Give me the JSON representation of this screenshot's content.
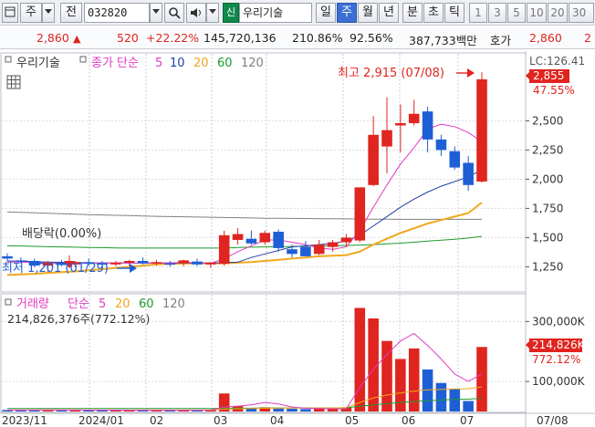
{
  "toolbar": {
    "window_icon": "window-icon",
    "market_label": "주",
    "prev_label": "전",
    "code": "032820",
    "stock_name": "우리기술",
    "period_day": "일",
    "period_week": "주",
    "period_month": "월",
    "period_year": "년",
    "period_min": "분",
    "period_sec": "초",
    "period_tick": "틱",
    "interval_1": "1",
    "interval_3": "3",
    "interval_5": "5",
    "interval_10": "10",
    "interval_20": "20",
    "interval_30": "30"
  },
  "quote": {
    "price": "2,860",
    "change": "520",
    "change_pct": "+22.22%",
    "volume": "145,720,136",
    "vol_ratio": "210.86%",
    "strength": "92.56%",
    "trade_value": "387,733백만",
    "ask_label": "호가",
    "ask_price": "2,860"
  },
  "legend": {
    "stock_name": "우리기술",
    "ma_label": "종가 단순",
    "ma5": "5",
    "ma10": "10",
    "ma20": "20",
    "ma60": "60",
    "ma120": "120",
    "lc": "LC:126.41"
  },
  "annotations": {
    "high": "최고 2,915 (07/08)",
    "dividend": "배당락(0.00%)",
    "low": "최저 1,201 (01/29)"
  },
  "price_label": {
    "price": "2,855",
    "pct": "47.55%"
  },
  "volume_legend": {
    "label": "거래량",
    "ma_label": "단순",
    "ma5": "5",
    "ma20": "20",
    "ma60": "60",
    "ma120": "120",
    "total": "214,826,376주(772.12%)"
  },
  "volume_label": {
    "value": "214,826K",
    "pct": "772.12%"
  },
  "colors": {
    "up": "#e0241f",
    "down": "#1f5fd6",
    "ma5": "#e03cc0",
    "ma10": "#1f3fa8",
    "ma20": "#f0a81e",
    "ma60": "#1c9a2a",
    "ma120": "#808080"
  },
  "chart_data": {
    "type": "candlestick",
    "price_axis": {
      "ticks": [
        "2,500",
        "2,250",
        "2,000",
        "1,750",
        "1,500",
        "1,250"
      ],
      "tick_values": [
        2500,
        2250,
        2000,
        1750,
        1500,
        1250
      ],
      "ylim": [
        1050,
        3050
      ]
    },
    "volume_axis": {
      "ticks": [
        "300,000K",
        "100,000K"
      ],
      "tick_values": [
        300000,
        100000
      ],
      "ylim": [
        0,
        380000
      ]
    },
    "x_axis": {
      "labels": [
        "2023/11",
        "2024/01",
        "02",
        "03",
        "04",
        "05",
        "06",
        "07",
        "07/08"
      ]
    },
    "candles": [
      {
        "o": 1340,
        "h": 1365,
        "l": 1295,
        "c": 1320
      },
      {
        "o": 1305,
        "h": 1330,
        "l": 1280,
        "c": 1300
      },
      {
        "o": 1300,
        "h": 1320,
        "l": 1245,
        "c": 1260
      },
      {
        "o": 1260,
        "h": 1300,
        "l": 1201,
        "c": 1285
      },
      {
        "o": 1285,
        "h": 1310,
        "l": 1255,
        "c": 1265
      },
      {
        "o": 1270,
        "h": 1300,
        "l": 1250,
        "c": 1290
      },
      {
        "o": 1290,
        "h": 1320,
        "l": 1260,
        "c": 1280
      },
      {
        "o": 1280,
        "h": 1300,
        "l": 1250,
        "c": 1270
      },
      {
        "o": 1270,
        "h": 1300,
        "l": 1255,
        "c": 1285
      },
      {
        "o": 1285,
        "h": 1310,
        "l": 1260,
        "c": 1300
      },
      {
        "o": 1300,
        "h": 1330,
        "l": 1270,
        "c": 1280
      },
      {
        "o": 1280,
        "h": 1310,
        "l": 1260,
        "c": 1290
      },
      {
        "o": 1280,
        "h": 1300,
        "l": 1250,
        "c": 1275
      },
      {
        "o": 1280,
        "h": 1310,
        "l": 1255,
        "c": 1305
      },
      {
        "o": 1295,
        "h": 1320,
        "l": 1255,
        "c": 1270
      },
      {
        "o": 1270,
        "h": 1290,
        "l": 1240,
        "c": 1285
      },
      {
        "o": 1275,
        "h": 1560,
        "l": 1260,
        "c": 1520
      },
      {
        "o": 1480,
        "h": 1580,
        "l": 1440,
        "c": 1530
      },
      {
        "o": 1490,
        "h": 1560,
        "l": 1440,
        "c": 1450
      },
      {
        "o": 1460,
        "h": 1560,
        "l": 1440,
        "c": 1540
      },
      {
        "o": 1550,
        "h": 1570,
        "l": 1380,
        "c": 1410
      },
      {
        "o": 1400,
        "h": 1440,
        "l": 1330,
        "c": 1360
      },
      {
        "o": 1420,
        "h": 1470,
        "l": 1340,
        "c": 1340
      },
      {
        "o": 1360,
        "h": 1480,
        "l": 1350,
        "c": 1440
      },
      {
        "o": 1420,
        "h": 1480,
        "l": 1380,
        "c": 1460
      },
      {
        "o": 1460,
        "h": 1530,
        "l": 1420,
        "c": 1500
      },
      {
        "o": 1475,
        "h": 1870,
        "l": 1460,
        "c": 1930
      },
      {
        "o": 1950,
        "h": 2540,
        "l": 1940,
        "c": 2380
      },
      {
        "o": 2280,
        "h": 2700,
        "l": 2050,
        "c": 2420
      },
      {
        "o": 2460,
        "h": 2640,
        "l": 2230,
        "c": 2480
      },
      {
        "o": 2480,
        "h": 2680,
        "l": 2460,
        "c": 2560
      },
      {
        "o": 2580,
        "h": 2620,
        "l": 2230,
        "c": 2340
      },
      {
        "o": 2340,
        "h": 2380,
        "l": 2200,
        "c": 2250
      },
      {
        "o": 2240,
        "h": 2280,
        "l": 2080,
        "c": 2100
      },
      {
        "o": 2140,
        "h": 2200,
        "l": 1900,
        "c": 1950
      },
      {
        "o": 1980,
        "h": 2915,
        "l": 1970,
        "c": 2855
      }
    ],
    "volumes": [
      5000,
      4000,
      4500,
      6000,
      5000,
      4500,
      4000,
      4000,
      5500,
      3500,
      4500,
      4000,
      4500,
      4000,
      4500,
      6000,
      60000,
      18000,
      12000,
      14000,
      10000,
      9000,
      8000,
      9000,
      10000,
      14000,
      345000,
      310000,
      235000,
      175000,
      210000,
      140000,
      95000,
      75000,
      35000,
      215000
    ],
    "ma5": [
      1290,
      1290,
      1285,
      1283,
      1282,
      1278,
      1280,
      1282,
      1284,
      1283,
      1282,
      1281,
      1284,
      1286,
      1285,
      1280,
      1320,
      1380,
      1430,
      1480,
      1480,
      1460,
      1440,
      1410,
      1400,
      1420,
      1560,
      1760,
      1950,
      2130,
      2270,
      2430,
      2470,
      2450,
      2400,
      2320
    ],
    "ma10": [
      1300,
      1298,
      1294,
      1290,
      1288,
      1286,
      1284,
      1283,
      1283,
      1283,
      1282,
      1281,
      1281,
      1282,
      1283,
      1283,
      1285,
      1290,
      1330,
      1360,
      1390,
      1420,
      1430,
      1440,
      1450,
      1470,
      1520,
      1600,
      1680,
      1760,
      1830,
      1890,
      1940,
      1980,
      2020,
      2080
    ],
    "ma20": [
      1180,
      1185,
      1190,
      1198,
      1205,
      1210,
      1220,
      1230,
      1240,
      1250,
      1260,
      1270,
      1275,
      1278,
      1280,
      1280,
      1280,
      1285,
      1290,
      1300,
      1310,
      1320,
      1330,
      1340,
      1345,
      1350,
      1380,
      1440,
      1490,
      1540,
      1580,
      1620,
      1650,
      1680,
      1710,
      1800
    ],
    "ma60": [
      1430,
      1428,
      1425,
      1422,
      1420,
      1418,
      1416,
      1414,
      1412,
      1410,
      1410,
      1410,
      1410,
      1410,
      1410,
      1410,
      1410,
      1415,
      1418,
      1420,
      1422,
      1424,
      1426,
      1428,
      1430,
      1432,
      1436,
      1440,
      1446,
      1452,
      1460,
      1470,
      1478,
      1486,
      1496,
      1510
    ],
    "ma120": [
      1720,
      1716,
      1712,
      1708,
      1704,
      1700,
      1697,
      1694,
      1691,
      1688,
      1685,
      1682,
      1680,
      1678,
      1676,
      1674,
      1672,
      1670,
      1668,
      1666,
      1665,
      1664,
      1663,
      1662,
      1661,
      1660,
      1659,
      1658,
      1657,
      1656,
      1656,
      1656,
      1656,
      1656,
      1656,
      1656
    ],
    "vma5": [
      5000,
      5000,
      5000,
      5200,
      5000,
      4800,
      4600,
      4500,
      4500,
      4300,
      4300,
      4300,
      4400,
      4400,
      4300,
      4700,
      15000,
      18000,
      22000,
      30000,
      25000,
      15000,
      11000,
      10000,
      9000,
      9000,
      80000,
      140000,
      190000,
      235000,
      260000,
      220000,
      175000,
      125000,
      100000,
      125000
    ],
    "vma20": [
      5000,
      5000,
      5000,
      5000,
      5000,
      5000,
      5000,
      5000,
      5000,
      5000,
      5000,
      5000,
      5000,
      5000,
      5000,
      5000,
      8000,
      9000,
      10000,
      11000,
      11000,
      12000,
      12000,
      12000,
      12000,
      13000,
      30000,
      45000,
      55000,
      62000,
      68000,
      72000,
      74000,
      75000,
      76000,
      82000
    ],
    "vma60": [
      10000,
      10000,
      10000,
      10000,
      10000,
      10000,
      10000,
      10000,
      10000,
      10000,
      10000,
      10000,
      10000,
      10000,
      10000,
      10000,
      11000,
      11000,
      11000,
      12000,
      12000,
      12000,
      12000,
      12000,
      12000,
      12000,
      18000,
      22000,
      26000,
      30000,
      33000,
      36000,
      38000,
      40000,
      41000,
      44000
    ]
  }
}
